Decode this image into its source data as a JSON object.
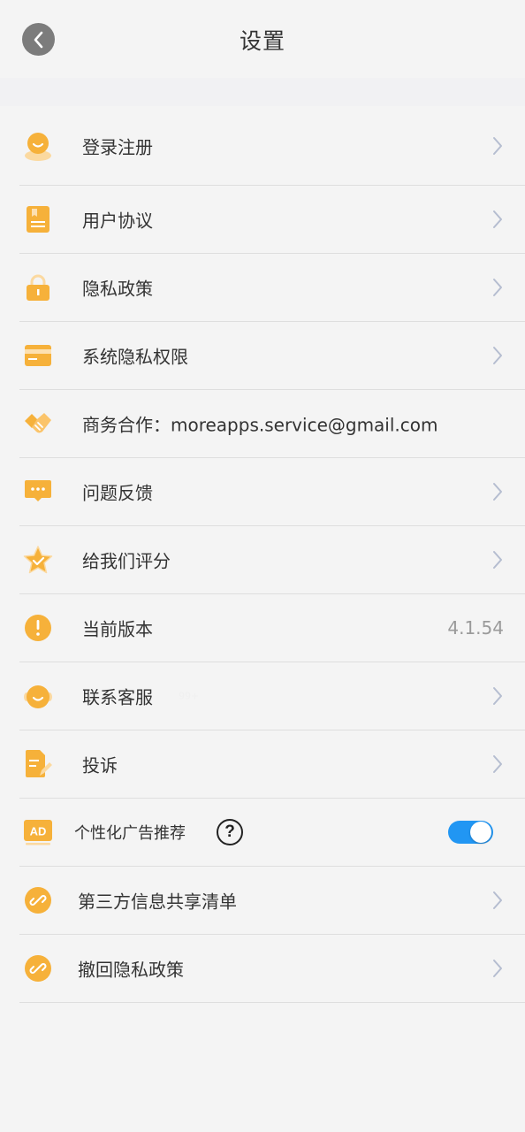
{
  "header": {
    "title": "设置"
  },
  "items": [
    {
      "label": "登录注册"
    },
    {
      "label": "用户协议"
    },
    {
      "label": "隐私政策"
    },
    {
      "label": "系统隐私权限"
    },
    {
      "label": "商务合作：moreapps.service@gmail.com"
    },
    {
      "label": "问题反馈"
    },
    {
      "label": "给我们评分"
    },
    {
      "label": "当前版本",
      "value": "4.1.54"
    },
    {
      "label": "联系客服",
      "badge": "99+"
    },
    {
      "label": "投诉"
    },
    {
      "label": "个性化广告推荐",
      "help": "?",
      "toggle_on": true
    },
    {
      "label": "第三方信息共享清单"
    },
    {
      "label": "撤回隐私政策"
    }
  ],
  "colors": {
    "accent": "#f6b13a",
    "toggle": "#2196f3",
    "chevron": "#b5bdd0"
  },
  "icons": [
    "user-avatar-icon",
    "document-icon",
    "lock-icon",
    "card-icon",
    "handshake-icon",
    "message-icon",
    "star-icon",
    "info-icon",
    "headset-icon",
    "edit-doc-icon",
    "ad-icon",
    "link-icon",
    "link-icon"
  ]
}
